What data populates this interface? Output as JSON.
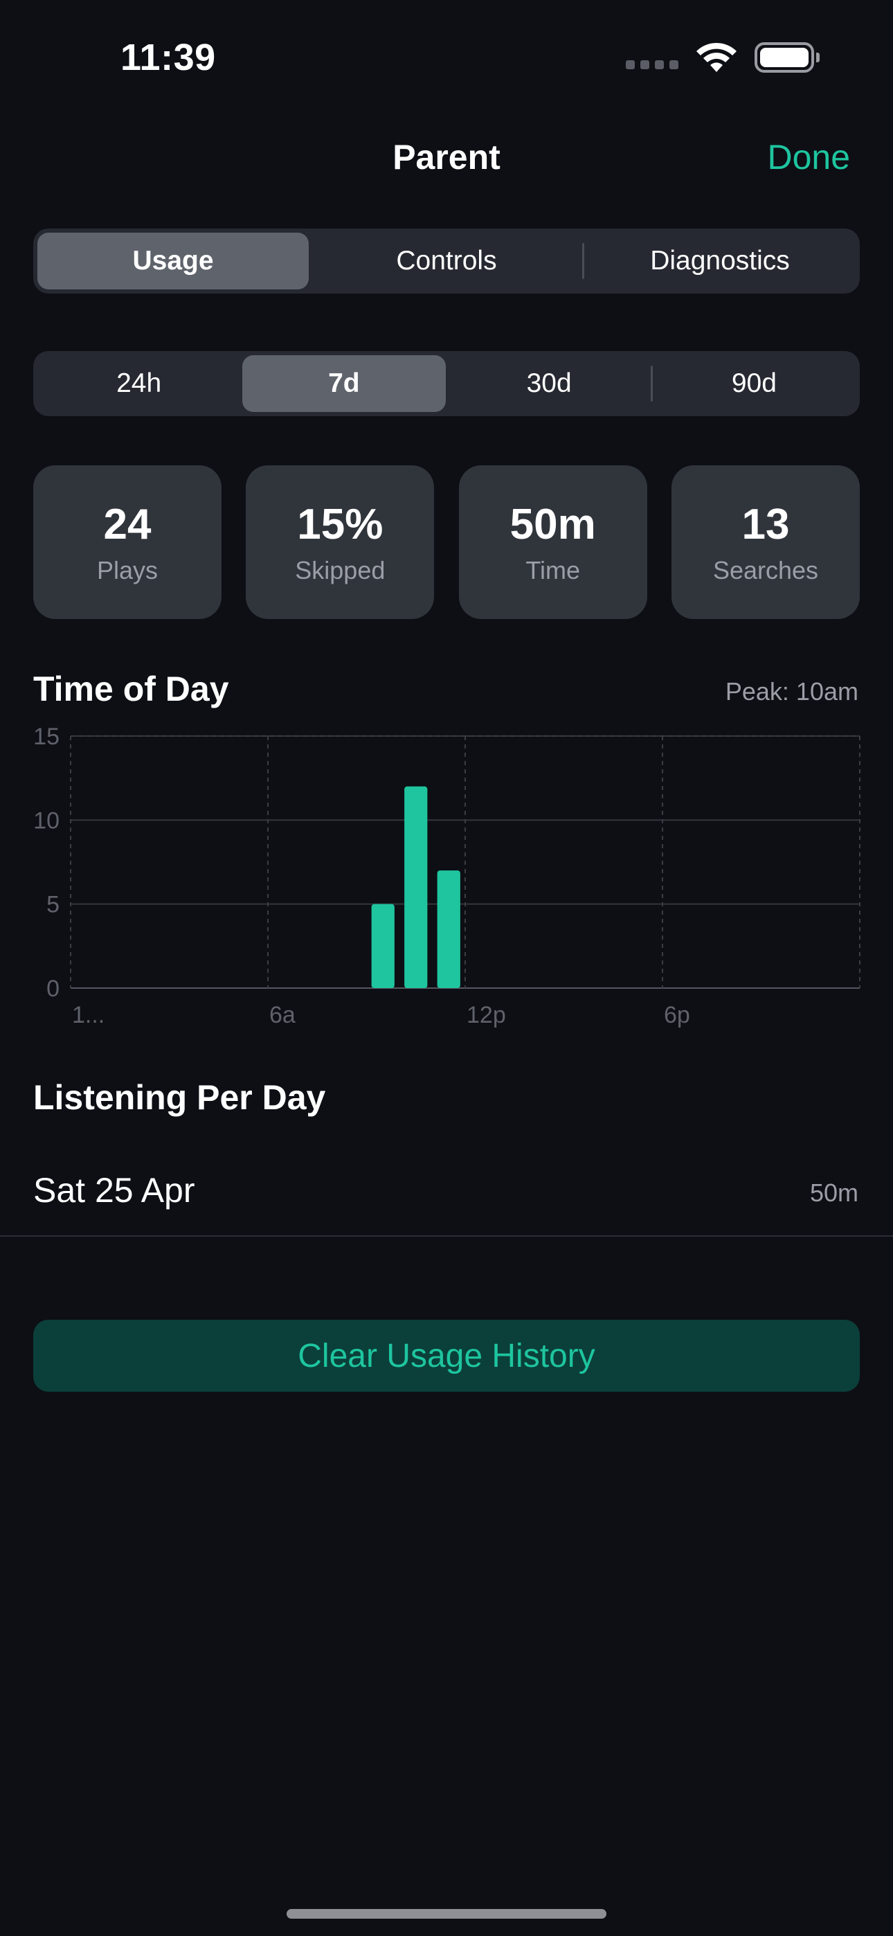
{
  "status_bar": {
    "time": "11:39"
  },
  "nav": {
    "title": "Parent",
    "done_label": "Done"
  },
  "main_tabs": [
    {
      "label": "Usage",
      "active": true
    },
    {
      "label": "Controls",
      "active": false
    },
    {
      "label": "Diagnostics",
      "active": false
    }
  ],
  "range_tabs": [
    {
      "label": "24h",
      "active": false
    },
    {
      "label": "7d",
      "active": true
    },
    {
      "label": "30d",
      "active": false
    },
    {
      "label": "90d",
      "active": false
    }
  ],
  "stats": [
    {
      "value": "24",
      "label": "Plays"
    },
    {
      "value": "15%",
      "label": "Skipped"
    },
    {
      "value": "50m",
      "label": "Time"
    },
    {
      "value": "13",
      "label": "Searches"
    }
  ],
  "time_of_day": {
    "title": "Time of Day",
    "peak_label": "Peak: 10am"
  },
  "chart_data": {
    "type": "bar",
    "x_tick_labels": [
      "1...",
      "6a",
      "12p",
      "6p"
    ],
    "y_ticks": [
      0,
      5,
      10,
      15
    ],
    "ylim": [
      0,
      15
    ],
    "xlim": [
      0,
      24
    ],
    "x": [
      9,
      10,
      11
    ],
    "values": [
      5,
      12,
      7
    ],
    "grid": true,
    "bar_color": "#1ec59f"
  },
  "per_day": {
    "title": "Listening Per Day",
    "rows": [
      {
        "date": "Sat 25 Apr",
        "value": "50m"
      }
    ]
  },
  "clear_button": {
    "label": "Clear Usage History"
  },
  "colors": {
    "accent": "#1ec59f",
    "background": "#0d0f15",
    "card": "#30343b"
  }
}
